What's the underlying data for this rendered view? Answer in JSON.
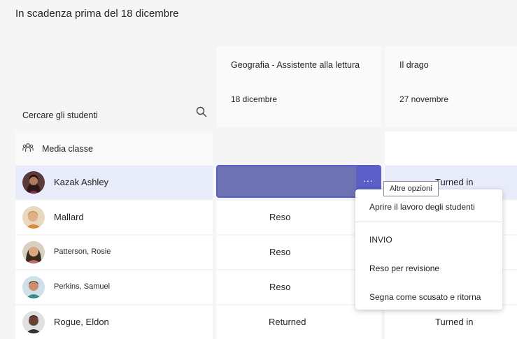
{
  "header": {
    "title": "In scadenza prima del 18 dicembre"
  },
  "assignments": [
    {
      "title": "Geografia - Assistente alla lettura",
      "date": "18 dicembre"
    },
    {
      "title": "Il drago",
      "date": "27 novembre"
    }
  ],
  "search": {
    "label": "Cercare gli studenti",
    "icon": "search-icon"
  },
  "class_average": {
    "label": "Media classe",
    "icon": "people-icon"
  },
  "students": [
    {
      "name": "Kazak Ashley",
      "col1": "",
      "col2": "Turned in"
    },
    {
      "name": "Mallard",
      "col1": "Reso",
      "col2": ""
    },
    {
      "name": "Patterson, Rosie",
      "col1": "Reso",
      "col2": ""
    },
    {
      "name": "Perkins, Samuel",
      "col1": "Reso",
      "col2": ""
    },
    {
      "name": "Rogue, Eldon",
      "col1": "Returned",
      "col2": "Turned in"
    }
  ],
  "more_button": {
    "glyph": "···"
  },
  "tooltip": {
    "text": "Altre opzioni"
  },
  "context_menu": {
    "items": [
      "Aprire il lavoro degli studenti",
      "INVIO",
      "Reso per revisione",
      "Segna come scusato e ritorna"
    ]
  },
  "colors": {
    "accent": "#5b5fc7",
    "selected_cell": "#6e72b2",
    "selected_row": "#e8ebf9"
  }
}
